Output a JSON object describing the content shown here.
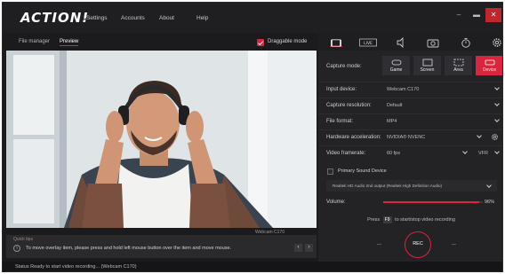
{
  "app": {
    "logo": "ACTION!",
    "menu": [
      "Settings",
      "Accounts",
      "About",
      "Help"
    ]
  },
  "left_tabs": {
    "file_manager": "File manager",
    "preview": "Preview",
    "draggable_mode": "Draggable mode"
  },
  "preview": {
    "webcam_label": "Webcam C170"
  },
  "quick_tips": {
    "title": "Quick tips",
    "text": "To move overlay item, please press and hold left mouse button over the item and move mouse."
  },
  "status": {
    "text": "Status  Ready to start video recording... (Webcam C170)"
  },
  "right_panel": {
    "icon_tabs": [
      "video-icon",
      "live-icon",
      "audio-icon",
      "screenshot-icon",
      "timer-icon",
      "gear-icon"
    ],
    "live_label": "LIVE",
    "capture_mode_label": "Capture mode:",
    "modes": [
      {
        "label": "Game",
        "icon": "gamepad-icon"
      },
      {
        "label": "Screen",
        "icon": "screen-icon"
      },
      {
        "label": "Area",
        "icon": "area-icon"
      },
      {
        "label": "Device",
        "icon": "device-icon"
      }
    ],
    "selected_mode": "Device",
    "input_device": {
      "label": "Input device:",
      "value": "Webcam C170"
    },
    "capture_resolution": {
      "label": "Capture resolution:",
      "value": "Default"
    },
    "file_format": {
      "label": "File format:",
      "value": "MP4"
    },
    "hardware_acceleration": {
      "label": "Hardware acceleration:",
      "value": "NVIDIA® NVENC"
    },
    "video_framerate": {
      "label": "Video framerate:",
      "value": "60 fps",
      "mode": "VFR"
    },
    "primary_sound": {
      "label": "Primary Sound Device",
      "checked": false
    },
    "audio_device": "Realtek HD Audio 2nd output (Realtek High Definition Audio)",
    "volume": {
      "label": "Volume:",
      "value": "96%",
      "level": 0.96
    },
    "hint_press": "Press",
    "hint_key": "F9",
    "hint_rest": "to start/stop video recording",
    "rec_label": "REC"
  },
  "colors": {
    "accent": "#d7263d",
    "panel": "#232326",
    "background": "#1b1b1d"
  }
}
